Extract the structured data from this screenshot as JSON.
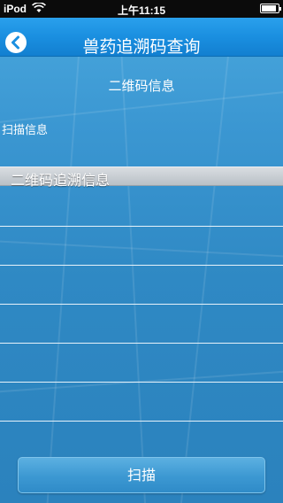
{
  "status_bar": {
    "carrier": "iPod",
    "time": "上午11:15",
    "wifi_icon": "wifi-icon",
    "battery_icon": "battery-icon",
    "battery_level": 0.9
  },
  "nav_bar": {
    "title": "兽药追溯码查询",
    "back_icon": "back-chevron-icon"
  },
  "content": {
    "section_heading": "二维码信息",
    "scan_info_label": "扫描信息",
    "trace_header": "二维码追溯信息",
    "trace_rows": [
      "",
      "",
      "",
      "",
      "",
      ""
    ]
  },
  "actions": {
    "scan_label": "扫描"
  },
  "colors": {
    "nav_bar": "#1a8fe0",
    "background": "#3b97d2",
    "header_gray": "#c4cacf"
  }
}
